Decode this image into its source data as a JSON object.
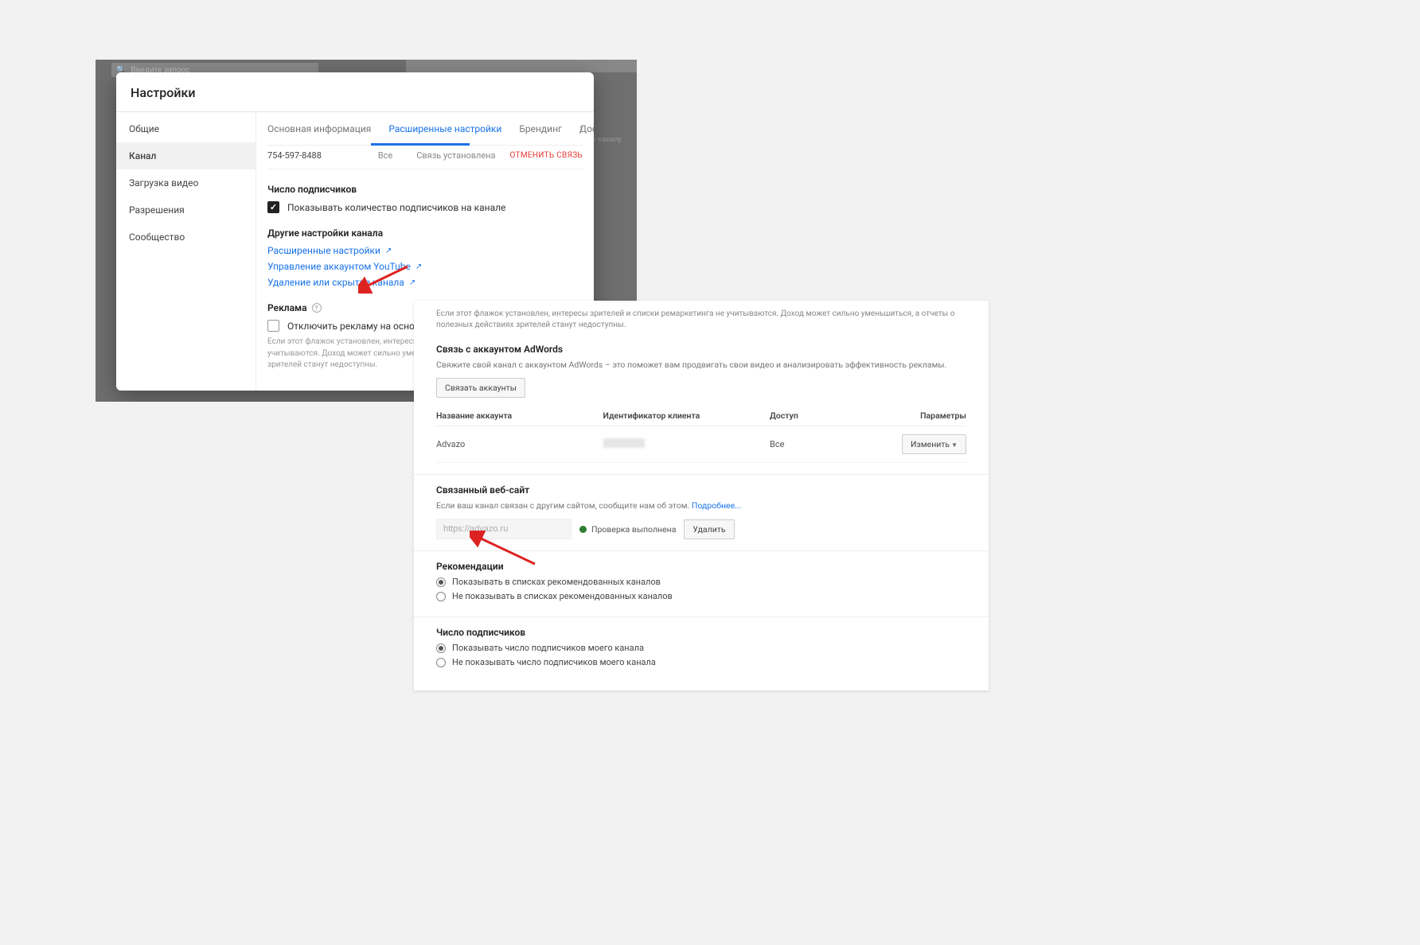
{
  "shot1_bg": {
    "search_placeholder": "Введите запрос",
    "right_text": "о каналу"
  },
  "modal": {
    "title": "Настройки",
    "sidenav": [
      {
        "label": "Общие"
      },
      {
        "label": "Канал"
      },
      {
        "label": "Загрузка видео"
      },
      {
        "label": "Разрешения"
      },
      {
        "label": "Сообщество"
      }
    ],
    "tabs": [
      {
        "label": "Основная информация"
      },
      {
        "label": "Расширенные настройки"
      },
      {
        "label": "Брендинг"
      },
      {
        "label": "Доступ"
      }
    ],
    "row": {
      "phone": "754-597-8488",
      "all": "Все",
      "status": "Связь установлена",
      "cancel": "ОТМЕНИТЬ СВЯЗЬ"
    },
    "subs": {
      "title": "Число подписчиков",
      "checkbox_label": "Показывать количество подписчиков на канале"
    },
    "other": {
      "title": "Другие настройки канала",
      "link1": "Расширенные настройки",
      "link2": "Управление аккаунтом YouTube",
      "link3": "Удаление или скрытие канала"
    },
    "ads": {
      "title": "Реклама",
      "checkbox_label": "Отключить рекламу на основе ин",
      "note": "Если этот флажок установлен, интересы зрителей и списки ремаркетинга не учитываются. Доход может сильно уменьшиться, а отчеты о полезных действиях зрителей станут недоступны."
    }
  },
  "shot2": {
    "notice": "Если этот флажок установлен, интересы зрителей и списки ремаркетинга не учитываются. Доход может сильно уменьшиться, а отчеты о полезных действиях зрителей станут недоступны.",
    "adwords": {
      "title": "Связь с аккаунтом AdWords",
      "desc": "Свяжите свой канал с аккаунтом AdWords – это поможет вам продвигать свои видео и анализировать эффективность рекламы.",
      "link_btn": "Связать аккаунты",
      "cols": {
        "c1": "Название аккаунта",
        "c2": "Идентификатор клиента",
        "c3": "Доступ",
        "c4": "Параметры"
      },
      "row": {
        "name": "Advazo",
        "access": "Все",
        "edit_btn": "Изменить"
      }
    },
    "website": {
      "title": "Связанный веб-сайт",
      "desc_pre": "Если ваш канал связан с другим сайтом, сообщите нам об этом. ",
      "desc_link": "Подробнее...",
      "input": "https://advazo.ru",
      "verify": "Проверка выполнена",
      "delete_btn": "Удалить"
    },
    "reco": {
      "title": "Рекомендации",
      "opt1": "Показывать в списках рекомендованных каналов",
      "opt2": "Не показывать в списках рекомендованных каналов"
    },
    "subs": {
      "title": "Число подписчиков",
      "opt1": "Показывать число подписчиков моего канала",
      "opt2": "Не показывать число подписчиков моего канала"
    }
  }
}
